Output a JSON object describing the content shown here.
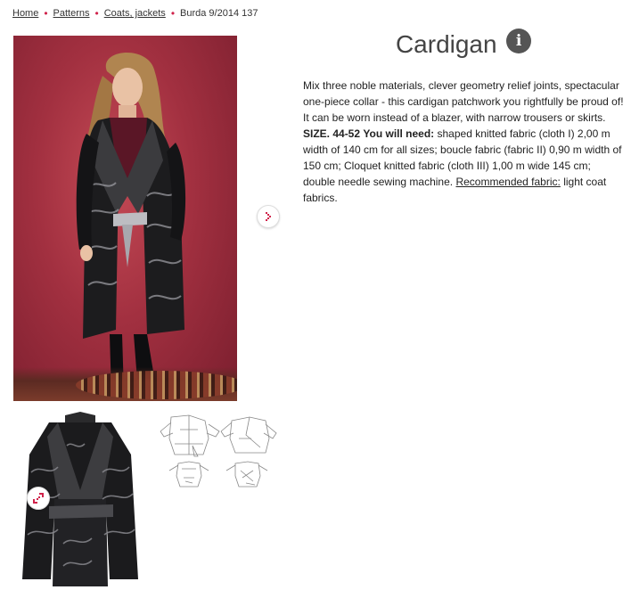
{
  "breadcrumb": {
    "items": [
      "Home",
      "Patterns",
      "Coats, jackets"
    ],
    "current": "Burda 9/2014 137"
  },
  "product": {
    "title": "Cardigan",
    "info_icon": "i",
    "description_intro": "Mix three noble materials, clever geometry relief joints, spectacular one-piece collar - this cardigan patchwork you rightfully be proud of! It can be worn instead of a blazer, with narrow trousers or skirts.",
    "size_label": "SIZE. 44-52",
    "need_label": "You will need:",
    "need_text": "shaped knitted fabric (cloth I) 2,00 m width of 140 cm for all sizes; boucle fabric (fabric II) 0,90 m width of 150 cm; Cloquet knitted fabric (cloth III) 1,00 m wide 145 cm; double needle sewing machine.",
    "recommended_label": "Recommended fabric:",
    "recommended_text": "light coat fabrics."
  },
  "colors": {
    "accent": "#d0234b",
    "title": "#444444",
    "photo_bg": "#a23040"
  },
  "icons": {
    "next": "chevron-right-icon",
    "zoom": "expand-icon",
    "info": "info-icon"
  }
}
